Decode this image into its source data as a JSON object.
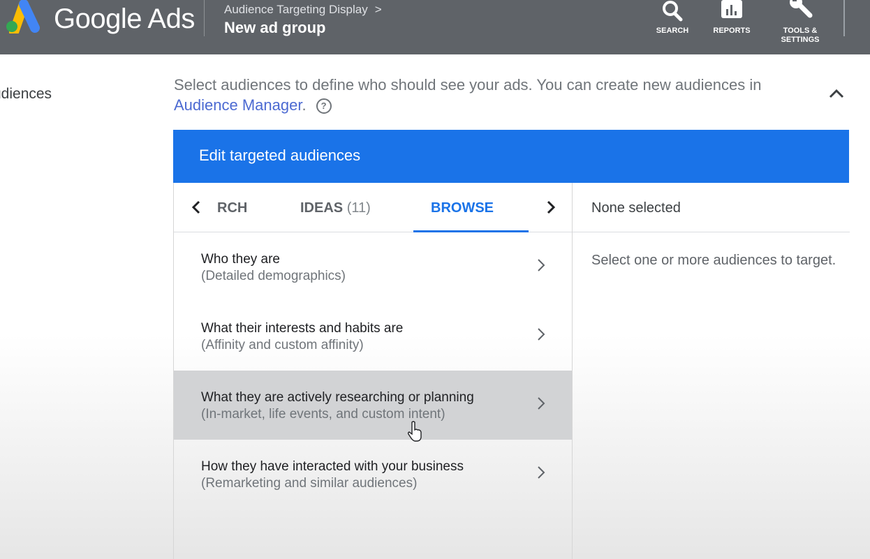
{
  "header": {
    "logo_text": "Google Ads",
    "breadcrumb": "Audience Targeting Display",
    "breadcrumb_chevron": ">",
    "title": "New ad group",
    "tools": [
      {
        "label": "SEARCH",
        "icon": "search-icon"
      },
      {
        "label": "REPORTS",
        "icon": "reports-icon"
      },
      {
        "label_line1": "TOOLS &",
        "label_line2": "SETTINGS",
        "icon": "wrench-icon"
      }
    ],
    "bg_color": "#5f6368"
  },
  "section": {
    "label": "udiences",
    "description_prefix": "Select audiences to define who should see your ads.  You can create new audiences in ",
    "description_link": "Audience Manager",
    "description_suffix": ".",
    "help_glyph": "?"
  },
  "panel": {
    "title": "Edit targeted audiences",
    "header_color": "#1a73e8",
    "tabs": [
      {
        "label": "RCH",
        "count": ""
      },
      {
        "label": "IDEAS",
        "count": "(11)"
      },
      {
        "label": "BROWSE",
        "count": "",
        "active": true
      }
    ],
    "rows": [
      {
        "title": "Who they are",
        "subtitle": "(Detailed demographics)"
      },
      {
        "title": "What their interests and habits are",
        "subtitle": "(Affinity and custom affinity)"
      },
      {
        "title": "What they are actively researching or planning",
        "subtitle": "(In-market, life events, and custom intent)",
        "hovered": true
      },
      {
        "title": "How they have interacted with your business",
        "subtitle": "(Remarketing and similar audiences)"
      }
    ],
    "selected_header": "None selected",
    "selected_hint": "Select one or more audiences to target."
  }
}
